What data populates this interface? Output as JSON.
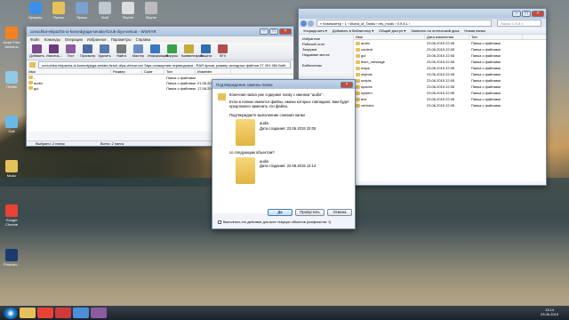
{
  "desktop": {
    "icons_left": [
      {
        "label": "Avast Free Antivirus",
        "color": "#f58220"
      },
      {
        "label": "iTunes",
        "color": "#8ecae6"
      },
      {
        "label": "Call",
        "color": "#6bb8e8"
      },
      {
        "label": "Music",
        "color": "#e6c15a"
      },
      {
        "label": "Google Chrome",
        "color": "#e94235"
      },
      {
        "label": "Photosh...",
        "color": "#1b3b6f"
      }
    ],
    "icons_top": [
      {
        "label": "Браузер",
        "color": "#3d8ee8"
      },
      {
        "label": "Ярлык",
        "color": "#e6c15a"
      },
      {
        "label": "Ярлык",
        "color": "#7aa2cc"
      },
      {
        "label": "Мой",
        "color": "#c0c8d0"
      },
      {
        "label": "Skyrim",
        "color": "#ddd"
      },
      {
        "label": "Skyrim",
        "color": "#bbb"
      }
    ]
  },
  "winrar": {
    "title": "ozvuchka-ekipazha-iz-komedyjoga-seriala-fizruk-diya-vietcar - WinRAR",
    "menu": [
      "Файл",
      "Команды",
      "Операции",
      "Избранное",
      "Параметры",
      "Справка"
    ],
    "toolbar": [
      {
        "label": "Добавить",
        "icon": "add-icon",
        "color": "#7a4a8e"
      },
      {
        "label": "Извлечь...",
        "icon": "extract-icon",
        "color": "#6a3c7e"
      },
      {
        "label": "Тест",
        "icon": "test-icon",
        "color": "#8c5ca0"
      },
      {
        "label": "Просмотр",
        "icon": "view-icon",
        "color": "#4d6ba3"
      },
      {
        "label": "Удалить",
        "icon": "delete-icon",
        "color": "#5b7ab0"
      },
      {
        "label": "Найти",
        "icon": "find-icon",
        "color": "#7a7a7a"
      },
      {
        "label": "Мастер",
        "icon": "wizard-icon",
        "color": "#6c8dc4"
      },
      {
        "label": "Информация",
        "icon": "info-icon",
        "color": "#3a78c2"
      },
      {
        "label": "Вирусы",
        "icon": "virus-scan-icon",
        "color": "#3aa04a"
      },
      {
        "label": "Комментарий",
        "icon": "comment-icon",
        "color": "#c8a93c"
      },
      {
        "label": "Защита",
        "icon": "protect-icon",
        "color": "#2f6fb0"
      },
      {
        "label": "SFX",
        "icon": "sfx-icon",
        "color": "#b05050"
      }
    ],
    "address": "ozvuchka-ekipazha-iz-komedyjoga-seriala-fizruk-dlya-vietcar.rar\\ Звук оснащения переводчика - RAR архив, размер исходных файлов 27 391 984 байт",
    "columns": [
      "Имя",
      "Размер",
      "Сжат",
      "Тип",
      "Изменён"
    ],
    "rows": [
      {
        "name": "..",
        "size": "",
        "packed": "",
        "type": "Папка с файлами",
        "modified": ""
      },
      {
        "name": "audio",
        "size": "",
        "packed": "",
        "type": "Папка с файлами",
        "modified": "21.06.2014"
      },
      {
        "name": "gui",
        "size": "",
        "packed": "",
        "type": "Папка с файлами",
        "modified": "17.06.2014"
      }
    ],
    "status_left": "Выбрано: 2 папок",
    "status_right": "Всего: 2 папок"
  },
  "explorer": {
    "breadcrumb": "« Компьютер › 1 › World_of_Tanks › res_mods › 0.9.8.1 ›",
    "search_placeholder": "Поиск: 0.9.8.1",
    "commands": [
      "Упорядочить ▾",
      "Добавить в библиотеку ▾",
      "Общий доступ ▾",
      "Записать на оптический диск",
      "Новая папка"
    ],
    "nav": [
      "Избранное",
      "Рабочий стол",
      "Загрузки",
      "Недавние места",
      "",
      "Библиотеки"
    ],
    "columns": [
      "Имя",
      "Дата изменения",
      "Тип"
    ],
    "rows": [
      {
        "name": "audio",
        "date": "23.06.2015 22:05",
        "type": "Папка с файлами"
      },
      {
        "name": "content",
        "date": "23.06.2015 22:05",
        "type": "Папка с файлами"
      },
      {
        "name": "gui",
        "date": "23.06.2015 22:05",
        "type": "Папка с файлами"
      },
      {
        "name": "lknm_message",
        "date": "23.06.2015 22:05",
        "type": "Папка с файлами"
      },
      {
        "name": "maps",
        "date": "23.06.2015 22:05",
        "type": "Папка с файлами"
      },
      {
        "name": "objects",
        "date": "23.06.2015 22:05",
        "type": "Папка с файлами"
      },
      {
        "name": "scripts",
        "date": "23.06.2015 22:05",
        "type": "Папка с файлами"
      },
      {
        "name": "spaces",
        "date": "23.06.2015 22:05",
        "type": "Папка с файлами"
      },
      {
        "name": "system",
        "date": "23.06.2015 22:05",
        "type": "Папка с файлами"
      },
      {
        "name": "text",
        "date": "23.06.2015 22:05",
        "type": "Папка с файлами"
      },
      {
        "name": "vehicles",
        "date": "23.06.2015 22:05",
        "type": "Папка с файлами"
      }
    ]
  },
  "dialog": {
    "title": "Подтверждение замены папки",
    "message": "Конечная папка уже содержит папку с именем \"audio\".",
    "message2": "Если в папках имеются файлы, имена которых совпадают, вам будет предложено заменить эти файлы.",
    "question": "Подтверждаете выполнение слияния папки",
    "existing": {
      "name": "audio",
      "date": "Дата создания: 23.06.2015 22:05"
    },
    "with_label": "со следующим объектом?",
    "incoming": {
      "name": "audio",
      "date": "Дата создания: 22.06.2015 12:14"
    },
    "btn_yes": "Да",
    "btn_skip": "Пропустить",
    "btn_cancel": "Отмена",
    "checkbox": "Выполнять это действие для всех текущих объектов (конфликтов: 1)"
  },
  "taskbar": {
    "items": [
      {
        "name": "folder-task",
        "color": "#e6c15a"
      },
      {
        "name": "chrome-task",
        "color": "#e94235"
      },
      {
        "name": "record-task",
        "color": "#d13a3a"
      },
      {
        "name": "media-task",
        "color": "#4a90d9"
      },
      {
        "name": "winrar-task",
        "color": "#8c5ca0"
      }
    ],
    "time": "13:14",
    "date": "23.06.2015"
  }
}
